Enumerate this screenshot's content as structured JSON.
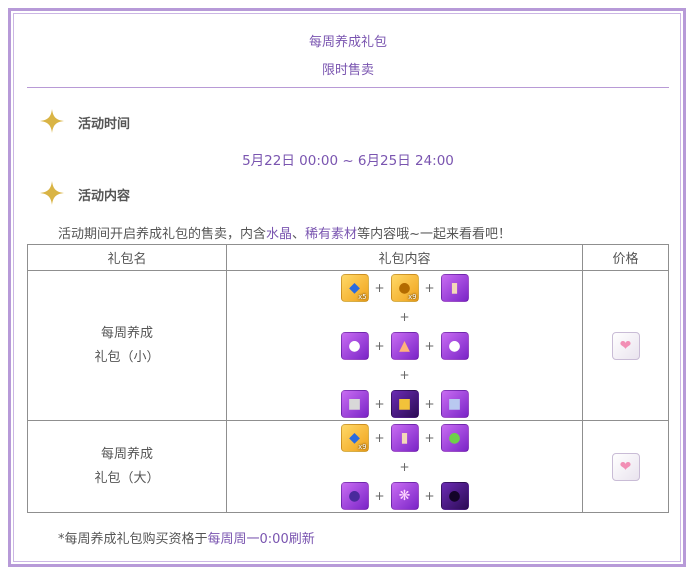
{
  "header": {
    "title": "每周养成礼包",
    "subtitle": "限时售卖"
  },
  "sections": {
    "time_title": "活动时间",
    "time_value": "5月22日 00:00 ~ 6月25日 24:00",
    "content_title": "活动内容",
    "desc_prefix": "活动期间开启养成礼包的售卖，内含",
    "desc_hl1": "水晶",
    "desc_sep": "、",
    "desc_hl2": "稀有素材",
    "desc_suffix": "等内容哦~一起来看看吧！"
  },
  "table": {
    "headers": [
      "礼包名",
      "礼包内容",
      "价格"
    ],
    "plus": "+",
    "rows": [
      {
        "name_line1": "每周养成",
        "name_line2": "礼包（小）"
      },
      {
        "name_line1": "每周养成",
        "name_line2": "礼包（大）"
      }
    ]
  },
  "icons": {
    "small_row1": [
      "crystal-icon",
      "coin-icon",
      "scroll-icon"
    ],
    "small_row2": [
      "ghost-icon",
      "shoe-icon",
      "ghost-icon"
    ],
    "small_row3": [
      "statue-icon",
      "statue-icon",
      "statue-icon"
    ],
    "large_row1": [
      "crystal-icon",
      "scroll-icon",
      "green-orb-icon"
    ],
    "large_row2": [
      "purple-disc-icon",
      "feather-icon",
      "dark-creature-icon"
    ],
    "price": "pink-bunny-icon"
  },
  "footer": {
    "note_prefix": "*每周养成礼包购买资格于",
    "note_hl": "每周周一0:00刷新"
  },
  "colors": {
    "accent": "#7a55b0",
    "border": "#b79ad8",
    "star": "#d9b445"
  }
}
